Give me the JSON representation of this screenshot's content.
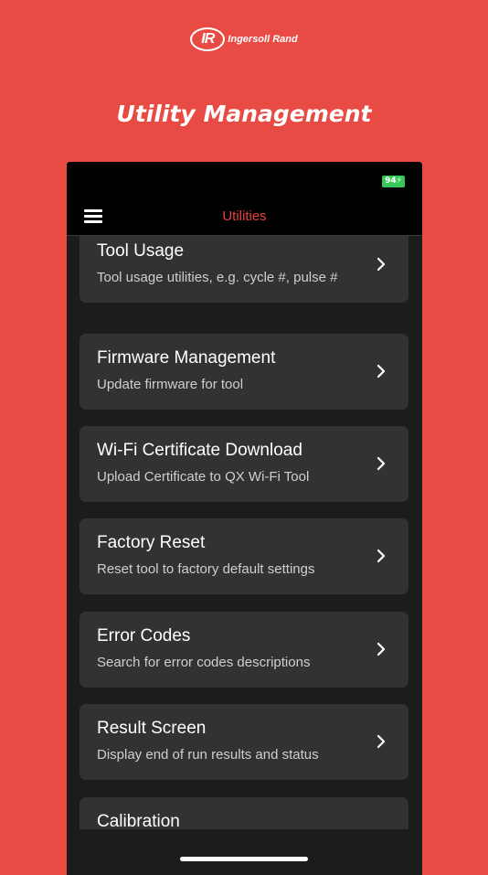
{
  "brand": {
    "mark": "IR",
    "name": "Ingersoll Rand"
  },
  "headline": "Utility Management",
  "status_bar": {
    "battery": "94"
  },
  "nav": {
    "title": "Utilities",
    "menu_icon": "hamburger-icon"
  },
  "items": [
    {
      "title": "Tool Usage",
      "subtitle": "Tool usage utilities, e.g. cycle #, pulse #"
    },
    {
      "title": "Firmware Management",
      "subtitle": "Update firmware for tool"
    },
    {
      "title": "Wi-Fi Certificate Download",
      "subtitle": "Upload Certificate to QX Wi-Fi Tool"
    },
    {
      "title": "Factory Reset",
      "subtitle": "Reset tool to factory default settings"
    },
    {
      "title": "Error Codes",
      "subtitle": "Search for error codes descriptions"
    },
    {
      "title": "Result Screen",
      "subtitle": "Display end of run results and status"
    },
    {
      "title": "Calibration",
      "subtitle": ""
    }
  ],
  "colors": {
    "background": "#e84b43",
    "accent": "#e8413a",
    "card": "#323232",
    "battery": "#35c759"
  }
}
